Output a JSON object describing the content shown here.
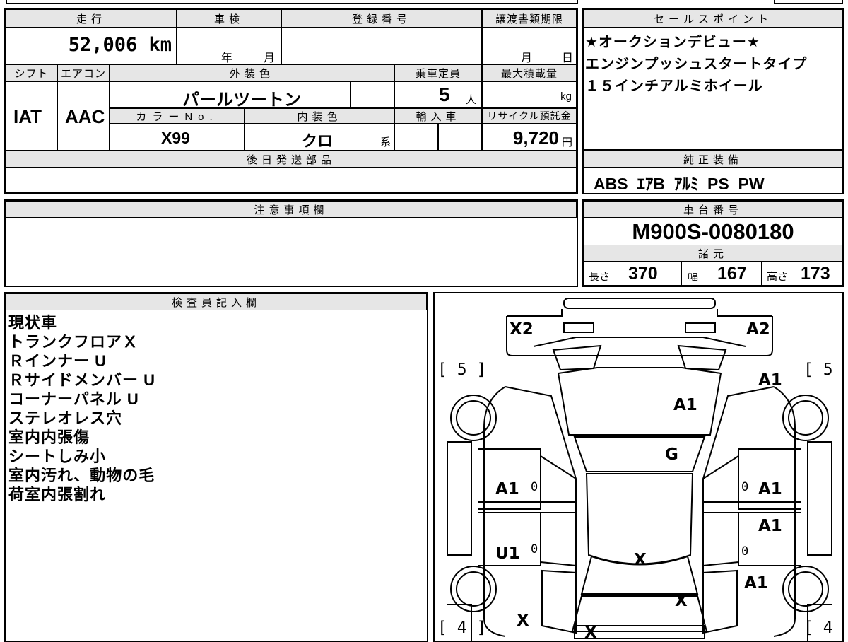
{
  "vehicle": {
    "mileage_label": "走行",
    "mileage_value": "52,006 km",
    "inspection_label": "車検",
    "inspection_year_unit": "年",
    "inspection_month_unit": "月",
    "registration_label": "登録番号",
    "transfer_deadline_label": "譲渡書類期限",
    "transfer_month_unit": "月",
    "transfer_day_unit": "日",
    "shift_label": "シフト",
    "shift_value": "IAT",
    "aircon_label": "エアコン",
    "aircon_value": "AAC",
    "exterior_color_label": "外装色",
    "exterior_color_value": "パールツートン",
    "capacity_label": "乗車定員",
    "capacity_value": "5",
    "capacity_unit": "人",
    "max_load_label": "最大積載量",
    "max_load_unit": "kg",
    "color_no_label": "カラーNo.",
    "color_no_value": "X99",
    "interior_color_label": "内装色",
    "interior_color_value": "クロ",
    "interior_color_suffix": "系",
    "import_label": "輸入車",
    "recycle_label": "リサイクル預託金",
    "recycle_value": "9,720",
    "recycle_unit": "円",
    "later_parts_label": "後日発送部品"
  },
  "sales_points": {
    "label": "セールスポイント",
    "lines": [
      "★オークションデビュー★",
      "エンジンプッシュスタートタイプ",
      "１５インチアルミホイール"
    ]
  },
  "standard_equipment": {
    "label": "純正装備",
    "value": "ABS  ｴｱB  ｱﾙﾐ  PS  PW"
  },
  "remarks": {
    "label": "注意事項欄"
  },
  "chassis": {
    "label": "車台番号",
    "value": "M900S-0080180",
    "specs_label": "諸元",
    "length_label": "長さ",
    "length_value": "370",
    "width_label": "幅",
    "width_value": "167",
    "height_label": "高さ",
    "height_value": "173"
  },
  "inspector": {
    "label": "検査員記入欄",
    "lines": [
      "現状車",
      "トランクフロアＸ",
      "Ｒインナー U",
      "Ｒサイドメンバー U",
      "コーナーパネル U",
      "ステレオレス穴",
      "室内内張傷",
      "シートしみ小",
      "室内汚れ、動物の毛",
      "荷室内張割れ"
    ]
  },
  "diagram": {
    "front_left_label": "X2",
    "front_right_label": "A2",
    "tire_front_left": "[ 5 ]",
    "tire_front_right": "[ 5 ]",
    "tire_rear_left": "[ 4 ]",
    "tire_rear_right": "[ 4 ]",
    "right_fender": "A1",
    "hood": "A1",
    "windshield": "G",
    "left_front_door": "A1",
    "right_front_door": "A1",
    "right_rear_door": "A1",
    "left_rear_door": "U1",
    "right_quarter": "A1",
    "roof": "X",
    "rear_glass": "X",
    "left_quarter": "X",
    "rear_bumper": "X",
    "zero_mark": "0"
  }
}
